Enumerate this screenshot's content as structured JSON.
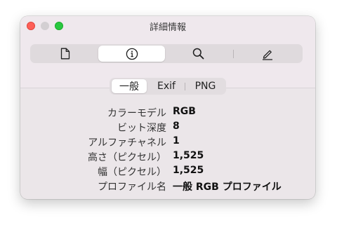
{
  "window": {
    "title": "詳細情報"
  },
  "toolbar": {
    "segments": [
      {
        "icon": "document-icon"
      },
      {
        "icon": "info-icon",
        "selected": true
      },
      {
        "icon": "search-icon"
      },
      {
        "icon": "pencil-icon"
      }
    ]
  },
  "tabs": [
    {
      "label": "一般",
      "selected": true
    },
    {
      "label": "Exif"
    },
    {
      "label": "PNG"
    }
  ],
  "info": [
    {
      "label": "カラーモデル",
      "value": "RGB"
    },
    {
      "label": "ビット深度",
      "value": "8"
    },
    {
      "label": "アルファチャネル",
      "value": "1"
    },
    {
      "label": "高さ（ピクセル）",
      "value": "1,525"
    },
    {
      "label": "幅（ピクセル）",
      "value": "1,525"
    },
    {
      "label": "プロファイル名",
      "value": "一般 RGB プロファイル"
    }
  ],
  "colors": {
    "close": "#fe5f57",
    "minimize": "#d3cfd2",
    "zoom": "#29c840",
    "window_bg": "#ebe6e9",
    "selected_bg": "#ffffff"
  }
}
